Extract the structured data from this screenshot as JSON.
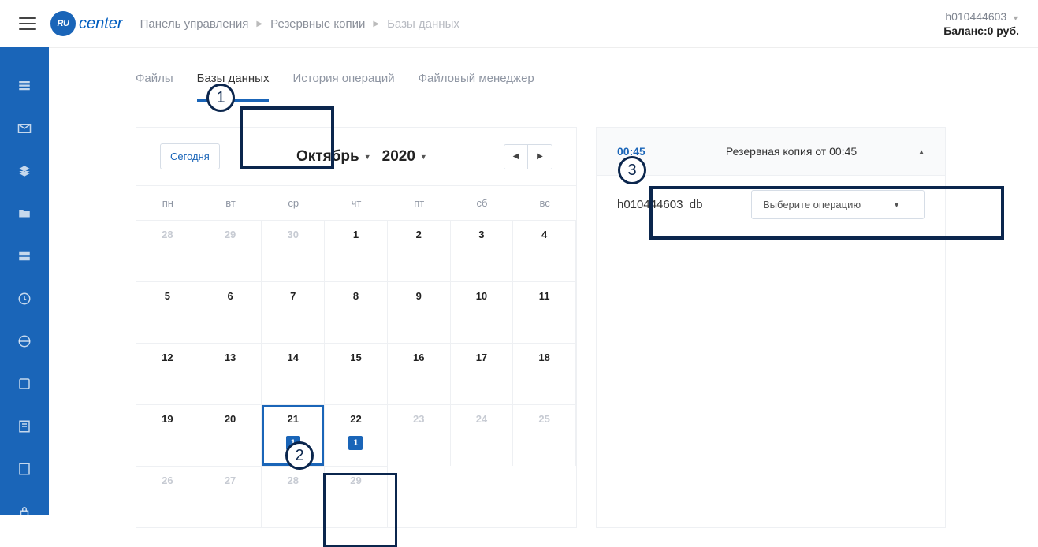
{
  "header": {
    "logo_badge": "RU",
    "logo_text": "center",
    "breadcrumbs": [
      "Панель управления",
      "Резервные копии",
      "Базы данных"
    ],
    "account_id": "h010444603",
    "balance_label": "Баланс:",
    "balance_value": "0 руб."
  },
  "tabs": [
    {
      "label": "Файлы",
      "active": false
    },
    {
      "label": "Базы данных",
      "active": true
    },
    {
      "label": "История операций",
      "active": false
    },
    {
      "label": "Файловый менеджер",
      "active": false
    }
  ],
  "calendar": {
    "today_label": "Сегодня",
    "month": "Октябрь",
    "year": "2020",
    "weekdays": [
      "пн",
      "вт",
      "ср",
      "чт",
      "пт",
      "сб",
      "вс"
    ],
    "cells": [
      {
        "d": "28",
        "other": true
      },
      {
        "d": "29",
        "other": true
      },
      {
        "d": "30",
        "other": true
      },
      {
        "d": "1"
      },
      {
        "d": "2"
      },
      {
        "d": "3"
      },
      {
        "d": "4"
      },
      {
        "d": "5"
      },
      {
        "d": "6"
      },
      {
        "d": "7"
      },
      {
        "d": "8"
      },
      {
        "d": "9"
      },
      {
        "d": "10"
      },
      {
        "d": "11"
      },
      {
        "d": "12"
      },
      {
        "d": "13"
      },
      {
        "d": "14"
      },
      {
        "d": "15"
      },
      {
        "d": "16"
      },
      {
        "d": "17"
      },
      {
        "d": "18"
      },
      {
        "d": "19"
      },
      {
        "d": "20"
      },
      {
        "d": "21",
        "badge": "1",
        "selected": true
      },
      {
        "d": "22",
        "badge": "1"
      },
      {
        "d": "23",
        "other": true
      },
      {
        "d": "24",
        "other": true
      },
      {
        "d": "25",
        "other": true
      },
      {
        "d": "26",
        "other": true
      },
      {
        "d": "27",
        "other": true
      },
      {
        "d": "28",
        "other": true
      },
      {
        "d": "29",
        "other": true
      }
    ]
  },
  "backup": {
    "time": "00:45",
    "label": "Резервная копия от 00:45",
    "db_name": "h010444603_db",
    "op_placeholder": "Выберите операцию"
  },
  "annotations": {
    "a1": "1",
    "a2": "2",
    "a3": "3"
  }
}
